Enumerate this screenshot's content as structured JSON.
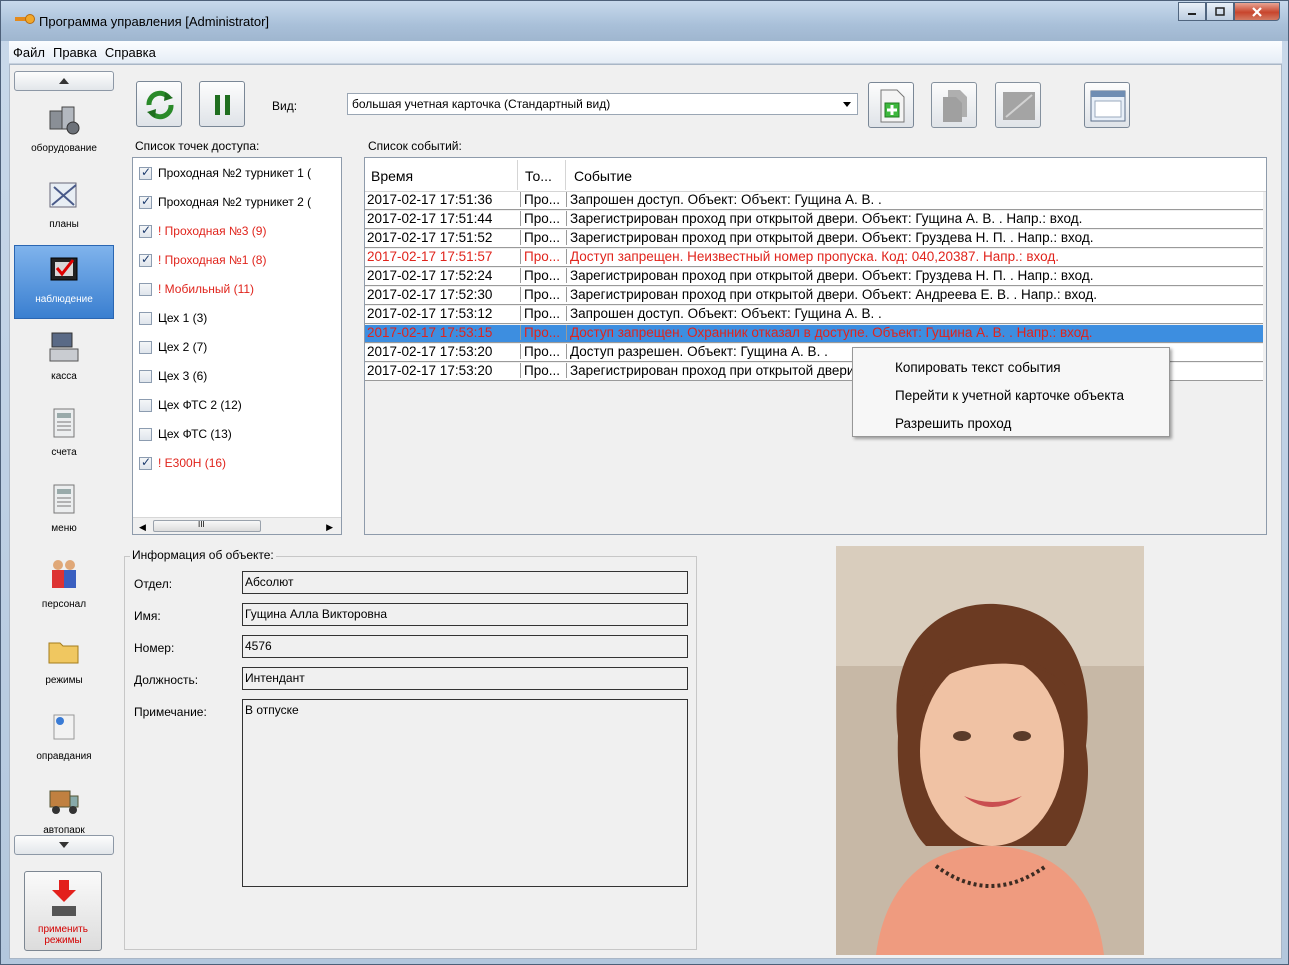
{
  "window": {
    "title": "Программа управления [Administrator]",
    "colors": {
      "titlebar": "#a9c0d9",
      "selection": "#3d8ee0",
      "alert_text": "#e0241c",
      "active_nav": "#3a7fd0"
    }
  },
  "menu": {
    "items": [
      "Файл",
      "Правка",
      "Справка"
    ]
  },
  "nav": {
    "items": [
      {
        "label": "оборудование",
        "icon": "equipment-icon"
      },
      {
        "label": "планы",
        "icon": "plans-icon"
      },
      {
        "label": "наблюдение",
        "icon": "monitoring-icon",
        "active": true
      },
      {
        "label": "касса",
        "icon": "cash-register-icon"
      },
      {
        "label": "счета",
        "icon": "accounts-icon"
      },
      {
        "label": "меню",
        "icon": "menu-calculator-icon"
      },
      {
        "label": "персонал",
        "icon": "personnel-icon"
      },
      {
        "label": "режимы",
        "icon": "modes-folder-icon"
      },
      {
        "label": "оправдания",
        "icon": "excuses-icon"
      },
      {
        "label": "автопарк",
        "icon": "fleet-truck-icon"
      }
    ],
    "apply_line1": "применить",
    "apply_line2": "режимы"
  },
  "toolbar": {
    "view_label": "Вид:",
    "view_value": "большая учетная карточка (Стандартный вид)",
    "refresh_icon": "refresh-icon",
    "pause_icon": "pause-icon"
  },
  "access_points": {
    "label": "Список точек доступа:",
    "items": [
      {
        "text": "Проходная №2 турникет 1 (",
        "checked": true,
        "alert": false
      },
      {
        "text": "Проходная №2 турникет 2 (",
        "checked": true,
        "alert": false
      },
      {
        "text": "! Проходная №3 (9)",
        "checked": true,
        "alert": true
      },
      {
        "text": "! Проходная №1 (8)",
        "checked": true,
        "alert": true
      },
      {
        "text": "! Мобильный (11)",
        "checked": false,
        "alert": true
      },
      {
        "text": "Цех 1 (3)",
        "checked": false,
        "alert": false
      },
      {
        "text": "Цех 2 (7)",
        "checked": false,
        "alert": false
      },
      {
        "text": "Цех 3 (6)",
        "checked": false,
        "alert": false
      },
      {
        "text": "Цех ФТС 2 (12)",
        "checked": false,
        "alert": false
      },
      {
        "text": "Цех ФТС (13)",
        "checked": false,
        "alert": false
      },
      {
        "text": "! Е300Н (16)",
        "checked": true,
        "alert": true
      }
    ],
    "scroll_thumb": "III"
  },
  "events": {
    "label": "Список событий:",
    "columns": [
      "Время",
      "То...",
      "Событие"
    ],
    "rows": [
      {
        "time": "2017-02-17 17:51:36",
        "point": "Про...",
        "event": "Запрошен доступ. Объект: Объект: Гущина А. В. .",
        "alert": false
      },
      {
        "time": "2017-02-17 17:51:44",
        "point": "Про...",
        "event": "Зарегистрирован проход при открытой двери. Объект: Гущина А. В. . Напр.: вход.",
        "alert": false
      },
      {
        "time": "2017-02-17 17:51:52",
        "point": "Про...",
        "event": "Зарегистрирован проход при открытой двери. Объект: Груздева Н. П. . Напр.: вход.",
        "alert": false
      },
      {
        "time": "2017-02-17 17:51:57",
        "point": "Про...",
        "event": "Доступ запрещен. Неизвестный номер пропуска. Код: 040,20387. Напр.: вход.",
        "alert": true
      },
      {
        "time": "2017-02-17 17:52:24",
        "point": "Про...",
        "event": "Зарегистрирован проход при открытой двери. Объект: Груздева Н. П. . Напр.: вход.",
        "alert": false
      },
      {
        "time": "2017-02-17 17:52:30",
        "point": "Про...",
        "event": "Зарегистрирован проход при открытой двери. Объект: Андреева Е. В. . Напр.: вход.",
        "alert": false
      },
      {
        "time": "2017-02-17 17:53:12",
        "point": "Про...",
        "event": "Запрошен доступ. Объект: Объект: Гущина А. В. .",
        "alert": false
      },
      {
        "time": "2017-02-17 17:53:15",
        "point": "Про...",
        "event": "Доступ запрещен. Охранник отказал в доступе. Объект: Гущина А. В. . Напр.: вход.",
        "alert": true,
        "selected": true
      },
      {
        "time": "2017-02-17 17:53:20",
        "point": "Про...",
        "event": "Доступ разрешен. Объект: Гущина А. В. .",
        "alert": false
      },
      {
        "time": "2017-02-17 17:53:20",
        "point": "Про...",
        "event": "Зарегистрирован проход при открытой двери. Объект: Гущина А. В. . Напр.: вход.",
        "alert": false
      }
    ]
  },
  "context_menu": {
    "items": [
      "Копировать текст события",
      "Перейти к учетной карточке объекта",
      "Разрешить проход"
    ]
  },
  "object_info": {
    "title": "Информация об объекте:",
    "fields": [
      {
        "label": "Отдел:",
        "value": "Абсолют"
      },
      {
        "label": "Имя:",
        "value": "Гущина Алла Викторовна"
      },
      {
        "label": "Номер:",
        "value": "4576"
      },
      {
        "label": "Должность:",
        "value": "Интендант"
      },
      {
        "label": "Примечание:",
        "value": "В отпуске"
      }
    ]
  }
}
